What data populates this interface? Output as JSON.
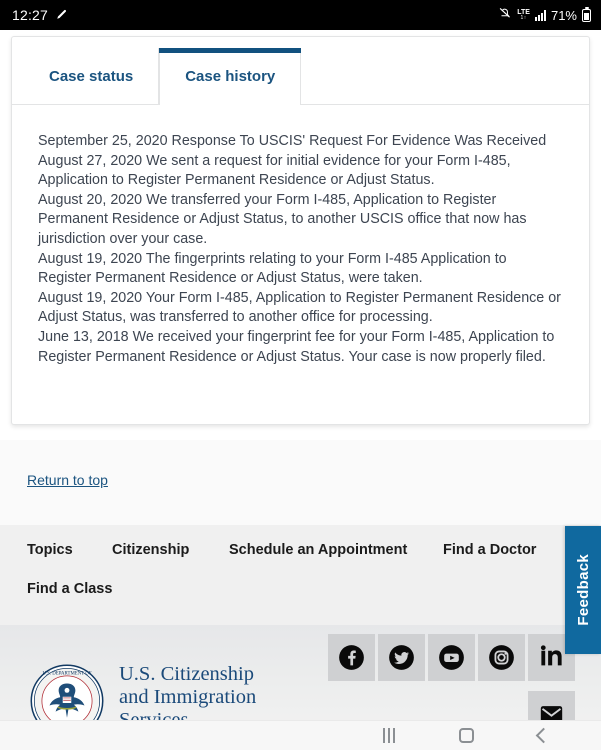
{
  "status_bar": {
    "time": "12:27",
    "pen_icon": "pen-icon",
    "mute_icon": "bell-muted-icon",
    "network_label": "LTE",
    "network_sub": "1↑",
    "signal_icon": "signal-bars-icon",
    "battery_percent": "71%",
    "battery_icon": "battery-icon"
  },
  "card": {
    "tabs": [
      {
        "label": "Case status",
        "active": false
      },
      {
        "label": "Case history",
        "active": true
      }
    ],
    "history_entries": [
      "September 25, 2020 Response To USCIS' Request For Evidence Was Received",
      "August 27, 2020 We sent a request for initial evidence for your Form I-485, Application to Register Permanent Residence or Adjust Status.",
      "August 20, 2020 We transferred your Form I-485, Application to Register Permanent Residence or Adjust Status, to another USCIS office that now has jurisdiction over your case.",
      "August 19, 2020 The fingerprints relating to your Form I-485 Application to Register Permanent Residence or Adjust Status, were taken.",
      "August 19, 2020 Your Form I-485, Application to Register Permanent Residence or Adjust Status, was transferred to another office for processing.",
      "June 13, 2018 We received your fingerprint fee for your Form I-485, Application to Register Permanent Residence or Adjust Status. Your case is now properly filed."
    ]
  },
  "footer": {
    "return_to_top": "Return to top",
    "links_row1": [
      "Topics",
      "Citizenship",
      "Schedule an Appointment",
      "Find a Doctor"
    ],
    "links_row2": [
      "Find a Class"
    ],
    "brand_line1": "U.S. Citizenship",
    "brand_line2": "and Immigration",
    "brand_line3": "Services",
    "seal_icon": "dhs-seal-icon",
    "social_icons": [
      {
        "name": "facebook-icon",
        "label": "Facebook"
      },
      {
        "name": "twitter-icon",
        "label": "Twitter"
      },
      {
        "name": "youtube-icon",
        "label": "YouTube"
      },
      {
        "name": "instagram-icon",
        "label": "Instagram"
      },
      {
        "name": "linkedin-icon",
        "label": "LinkedIn"
      }
    ],
    "email_icon": {
      "name": "email-icon",
      "label": "Email"
    }
  },
  "feedback": {
    "label": "Feedback"
  },
  "nav_bar": {
    "recents": "recents-icon",
    "home": "home-icon",
    "back": "back-icon"
  },
  "colors": {
    "accent_blue": "#11517f",
    "link_blue": "#1b5480",
    "feedback_blue": "#10699f",
    "brand_navy": "#1b4a7a",
    "body_text": "#3d4551"
  }
}
